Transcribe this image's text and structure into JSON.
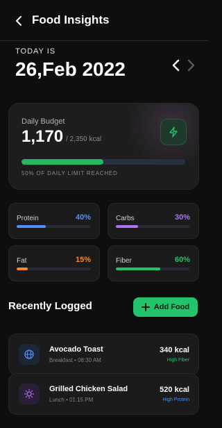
{
  "header": {
    "title": "Food Insights"
  },
  "date_section": {
    "label": "TODAY IS",
    "date": "26,Feb 2022"
  },
  "budget": {
    "label": "Daily Budget",
    "value": "1,170",
    "limit": "/ 2,350 kcal",
    "progress_fraction": 0.5,
    "caption": "50% OF DAILY LIMIT REACHED"
  },
  "macros": [
    {
      "name": "Protein",
      "percent": "40%",
      "value": 0.4,
      "color": "#4f8ff7"
    },
    {
      "name": "Carbs",
      "percent": "30%",
      "value": 0.3,
      "color": "#b072f5"
    },
    {
      "name": "Fat",
      "percent": "15%",
      "value": 0.15,
      "color": "#f08a2b"
    },
    {
      "name": "Fiber",
      "percent": "60%",
      "value": 0.6,
      "color": "#22c36a"
    }
  ],
  "recent": {
    "title": "Recently Logged",
    "add_label": "Add Food",
    "items": [
      {
        "name": "Avocado Toast",
        "meta": "Breakfast • 08:30 AM",
        "kcal": "340 kcal",
        "tag": "High Fiber",
        "tag_color": "#22c36a",
        "icon": "globe-icon"
      },
      {
        "name": "Grilled Chicken Salad",
        "meta": "Lunch • 01:15 PM",
        "kcal": "520 kcal",
        "tag": "High Protein",
        "tag_color": "#4f8ff7",
        "icon": "sun-icon"
      }
    ]
  }
}
